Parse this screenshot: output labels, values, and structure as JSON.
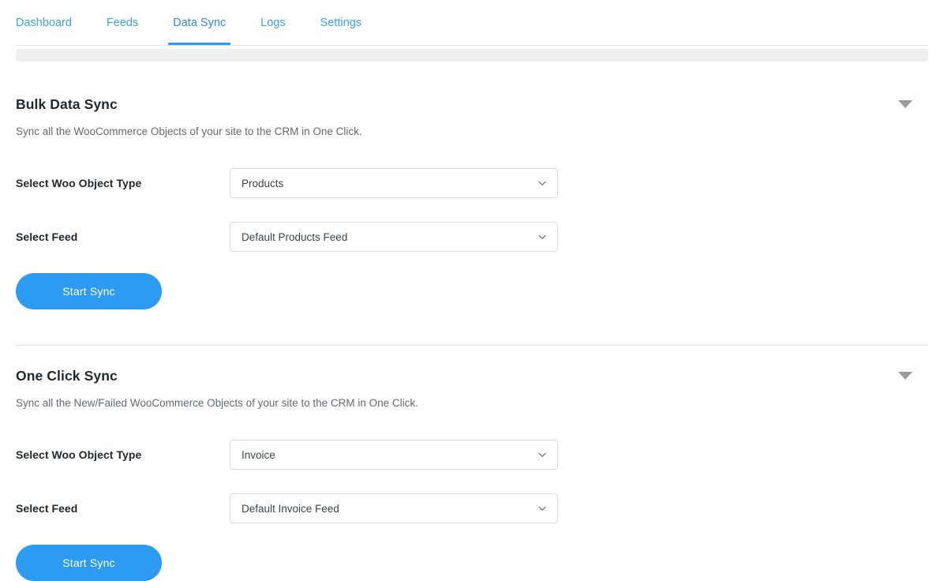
{
  "nav": {
    "tabs": [
      {
        "label": "Dashboard",
        "active": false
      },
      {
        "label": "Feeds",
        "active": false
      },
      {
        "label": "Data Sync",
        "active": true
      },
      {
        "label": "Logs",
        "active": false
      },
      {
        "label": "Settings",
        "active": false
      }
    ],
    "active_tab": "Data Sync",
    "link_color": "#3c9ff0",
    "active_underline_color": "#2e9bf3"
  },
  "colors": {
    "accent": "#2e9bf3",
    "heading": "#23282d",
    "muted_text": "#646970",
    "field_border": "#dcdcde",
    "band": "#efefef",
    "divider": "#e2e2e2",
    "caret": "#9b9b9b"
  },
  "sections": [
    {
      "title": "Bulk Data Sync",
      "description": "Sync all the WooCommerce Objects of your site to the CRM in One Click.",
      "collapse_icon": "caret-down-icon",
      "fields": [
        {
          "label": "Select Woo Object Type",
          "value": "Products",
          "icon": "chevron-down-icon"
        },
        {
          "label": "Select Feed",
          "value": "Default Products Feed",
          "icon": "chevron-down-icon"
        }
      ],
      "button_label": "Start Sync"
    },
    {
      "title": "One Click Sync",
      "description": "Sync all the New/Failed WooCommerce Objects of your site to the CRM in One Click.",
      "collapse_icon": "caret-down-icon",
      "fields": [
        {
          "label": "Select Woo Object Type",
          "value": "Invoice",
          "icon": "chevron-down-icon"
        },
        {
          "label": "Select Feed",
          "value": "Default Invoice Feed",
          "icon": "chevron-down-icon"
        }
      ],
      "button_label": "Start Sync"
    }
  ]
}
